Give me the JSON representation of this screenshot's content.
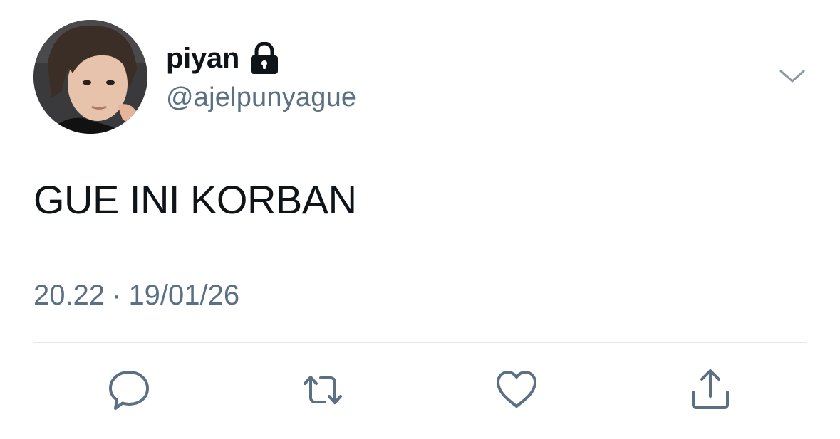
{
  "user": {
    "display_name": "piyan",
    "handle": "@ajelpunyague",
    "protected_icon": "lock-icon",
    "avatar_icon": "profile-photo"
  },
  "tweet": {
    "text": "GUE INI KORBAN",
    "time": "20.22",
    "separator": "·",
    "date": "19/01/26"
  },
  "menu": {
    "icon": "chevron-down-icon"
  },
  "actions": [
    {
      "name": "reply",
      "icon": "reply-icon"
    },
    {
      "name": "retweet",
      "icon": "retweet-icon"
    },
    {
      "name": "like",
      "icon": "heart-icon"
    },
    {
      "name": "share",
      "icon": "share-icon"
    }
  ],
  "colors": {
    "text": "#0f1419",
    "secondary": "#5b7083",
    "divider": "#e1e8ed",
    "icon": "#5b7083"
  }
}
